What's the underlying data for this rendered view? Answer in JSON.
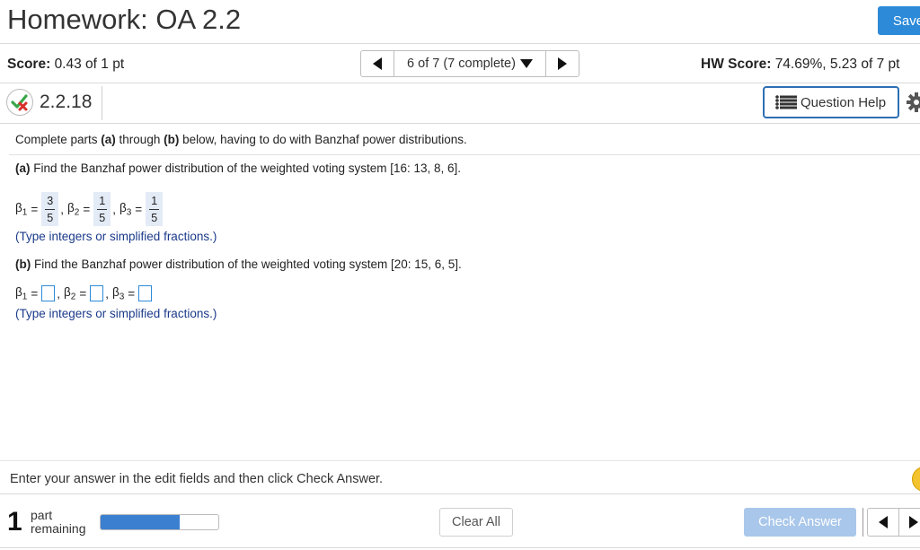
{
  "header": {
    "title": "Homework: OA 2.2",
    "save_label": "Save"
  },
  "score_bar": {
    "score_label": "Score:",
    "score_value": "0.43 of 1 pt",
    "question_selector": "6 of 7 (7 complete)",
    "hw_score_label": "HW Score:",
    "hw_score_value": "74.69%, 5.23 of 7 pt"
  },
  "question": {
    "number": "2.2.18",
    "help_label": "Question Help",
    "intro_prefix": "Complete parts ",
    "intro_a": "(a)",
    "intro_mid": " through ",
    "intro_b": "(b)",
    "intro_suffix": " below, having to do with Banzhaf power distributions.",
    "part_a_tag": "(a)",
    "part_a_text": " Find the Banzhaf power distribution of the weighted voting system [16: 13, 8, 6].",
    "part_a_answers": [
      {
        "symbol": "β",
        "sub": "1",
        "num": "3",
        "den": "5"
      },
      {
        "symbol": "β",
        "sub": "2",
        "num": "1",
        "den": "5"
      },
      {
        "symbol": "β",
        "sub": "3",
        "num": "1",
        "den": "5"
      }
    ],
    "part_a_hint": "(Type integers or simplified fractions.)",
    "part_b_tag": "(b)",
    "part_b_text": " Find the Banzhaf power distribution of the weighted voting system [20: 15, 6, 5].",
    "part_b_symbols": [
      {
        "symbol": "β",
        "sub": "1"
      },
      {
        "symbol": "β",
        "sub": "2"
      },
      {
        "symbol": "β",
        "sub": "3"
      }
    ],
    "part_b_hint": "(Type integers or simplified fractions.)",
    "eq": "="
  },
  "footer": {
    "instruction": "Enter your answer in the edit fields and then click Check Answer.",
    "remaining_count": "1",
    "remaining_line1": "part",
    "remaining_line2": "remaining",
    "progress_fraction": 0.67,
    "clear_label": "Clear All",
    "check_label": "Check Answer"
  },
  "colors": {
    "accent": "#2d8ad8",
    "help_border": "#2d6fb5",
    "check_disabled": "#a9c7ea",
    "progress_fill": "#3b7fd1",
    "hint_text": "#1a3a8a",
    "answer_bg": "#e3ebf6"
  },
  "icons": [
    "left-arrow-icon",
    "right-arrow-icon",
    "dropdown-caret-icon",
    "partial-correct-icon",
    "list-icon",
    "gear-icon",
    "partial-credit-icon"
  ]
}
